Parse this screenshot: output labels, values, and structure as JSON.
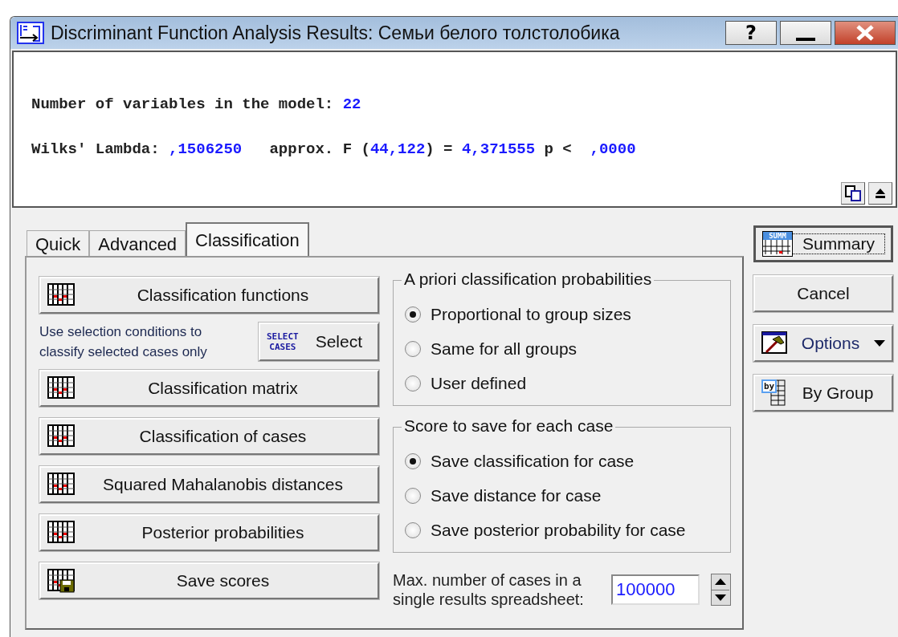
{
  "window": {
    "title": "Discriminant Function Analysis Results: Семьи белого толстолобика",
    "controls": [
      {
        "kind": "help",
        "label": "?"
      },
      {
        "kind": "minimize"
      },
      {
        "kind": "close"
      }
    ]
  },
  "output": {
    "lines": [
      [
        {
          "text": "Number of variables in the model: ",
          "kind": "label"
        },
        {
          "text": "22",
          "kind": "value"
        }
      ],
      [
        {
          "text": "Wilks' Lambda: ",
          "kind": "label"
        },
        {
          "text": ",1506250",
          "kind": "value"
        },
        {
          "text": "   approx. F (",
          "kind": "label"
        },
        {
          "text": "44,122",
          "kind": "value"
        },
        {
          "text": ") = ",
          "kind": "label"
        },
        {
          "text": "4,371555",
          "kind": "value"
        },
        {
          "text": " p < ",
          "kind": "label"
        },
        {
          "text": " ,0000",
          "kind": "value"
        }
      ]
    ],
    "tools": [
      {
        "kind": "copy"
      },
      {
        "kind": "collapse"
      }
    ]
  },
  "tabs": [
    {
      "label": "Quick",
      "selected": false
    },
    {
      "label": "Advanced",
      "selected": false
    },
    {
      "label": "Classification",
      "selected": true
    }
  ],
  "result_buttons": [
    {
      "label": "Classification functions",
      "kind": "table"
    },
    {
      "label": "Classification matrix",
      "kind": "table"
    },
    {
      "label": "Classification of cases",
      "kind": "table"
    },
    {
      "label": "Squared Mahalanobis distances",
      "kind": "table"
    },
    {
      "label": "Posterior probabilities",
      "kind": "table"
    },
    {
      "label": "Save scores",
      "kind": "save"
    }
  ],
  "select_cases": {
    "note": "Use selection conditions to classify selected cases only",
    "icon_text": [
      "SELECT",
      "CASES"
    ],
    "button": "Select"
  },
  "priori_group": {
    "title": "A priori classification probabilities",
    "options": [
      {
        "label": "Proportional to group sizes",
        "selected": true
      },
      {
        "label": "Same for all groups",
        "selected": false
      },
      {
        "label": "User defined",
        "selected": false
      }
    ]
  },
  "score_group": {
    "title": "Score to save for each case",
    "options": [
      {
        "label": "Save classification for case",
        "selected": true
      },
      {
        "label": "Save distance for case",
        "selected": false
      },
      {
        "label": "Save posterior probability for case",
        "selected": false
      }
    ]
  },
  "max_cases": {
    "label": "Max. number of cases in a single results spreadsheet:",
    "value": "100000"
  },
  "side_buttons": [
    {
      "label": "Summary",
      "kind": "summary",
      "icon_text": "SUMM",
      "focused": true
    },
    {
      "label": "Cancel",
      "kind": "plain",
      "focused": false
    },
    {
      "label": "Options",
      "kind": "options",
      "focused": false
    },
    {
      "label": "By Group",
      "kind": "bygroup",
      "icon_text": "by",
      "focused": false
    }
  ]
}
